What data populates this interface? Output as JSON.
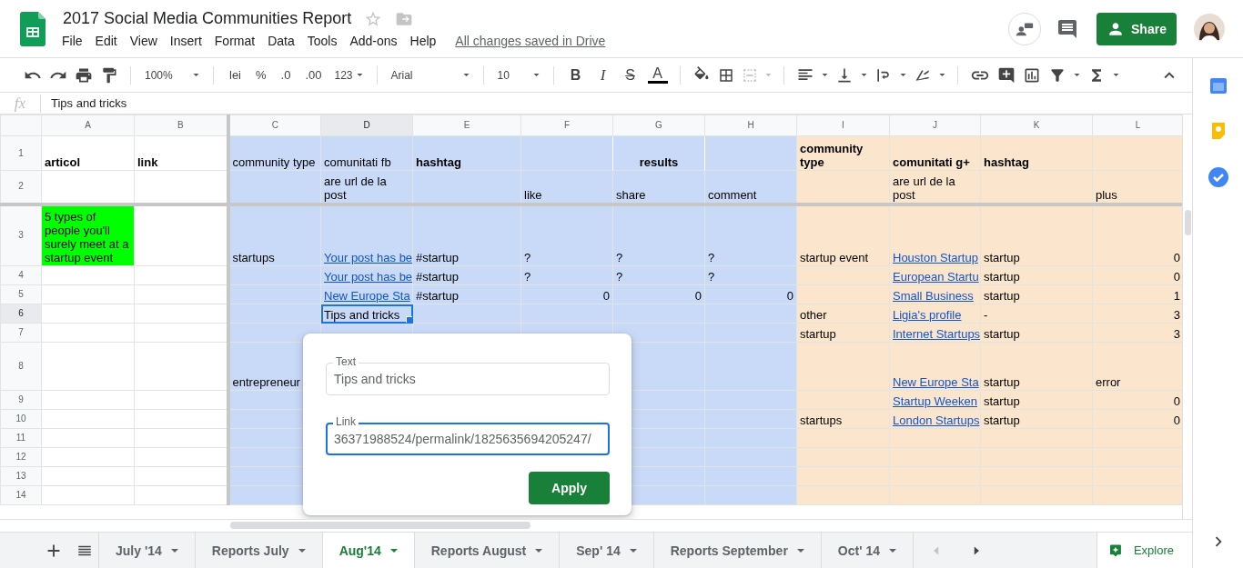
{
  "document": {
    "title": "2017 Social Media Communities Report",
    "starred": false,
    "save_status": "All changes saved in Drive"
  },
  "menu": [
    "File",
    "Edit",
    "View",
    "Insert",
    "Format",
    "Data",
    "Tools",
    "Add-ons",
    "Help"
  ],
  "share_button": "Share",
  "toolbar": {
    "zoom": "100%",
    "currency": "lei",
    "percent": "%",
    "decrease_decimals": ".0",
    "increase_decimals": ".00",
    "more_formats": "123",
    "font": "Arial",
    "font_size": "10",
    "bold": "B",
    "italic": "I",
    "strikethrough": "S",
    "text_color": "A"
  },
  "formula_bar": {
    "label": "fx",
    "value": "Tips and tricks"
  },
  "sheet": {
    "columns": [
      {
        "letter": "A",
        "selected": false
      },
      {
        "letter": "B",
        "selected": false
      },
      {
        "letter": "C",
        "selected": false,
        "color": "#c9daf8"
      },
      {
        "letter": "D",
        "selected": true,
        "color": "#c9daf8"
      },
      {
        "letter": "E",
        "selected": false,
        "color": "#c9daf8"
      },
      {
        "letter": "F",
        "selected": false,
        "color": "#c9daf8"
      },
      {
        "letter": "G",
        "selected": false,
        "color": "#c9daf8"
      },
      {
        "letter": "H",
        "selected": false,
        "color": "#c9daf8"
      },
      {
        "letter": "I",
        "selected": false,
        "color": "#fce5cd"
      },
      {
        "letter": "J",
        "selected": false,
        "color": "#fce5cd"
      },
      {
        "letter": "K",
        "selected": false,
        "color": "#fce5cd"
      },
      {
        "letter": "L",
        "selected": false,
        "color": "#fce5cd"
      }
    ],
    "rows": [
      {
        "number": "1",
        "selected": false,
        "cells": [
          {
            "text": "articol",
            "kind": "header",
            "selected": false
          },
          {
            "text": "link",
            "kind": "header",
            "selected": false
          },
          {
            "text": "community type",
            "kind": "text",
            "selected": false
          },
          {
            "text": "comunitati fb",
            "kind": "text",
            "selected": false
          },
          {
            "text": "hashtag",
            "kind": "header",
            "selected": false
          },
          null,
          {
            "text": "results",
            "kind": "group-header",
            "selected": false
          },
          null,
          {
            "text": "community type",
            "kind": "header",
            "selected": false
          },
          {
            "text": "comunitati g+",
            "kind": "header",
            "selected": false
          },
          {
            "text": "hashtag",
            "kind": "header",
            "selected": false
          },
          null
        ]
      },
      {
        "number": "2",
        "selected": false,
        "cells": [
          null,
          null,
          null,
          {
            "text": "are url de la post",
            "kind": "text",
            "selected": false
          },
          null,
          {
            "text": "like",
            "kind": "text",
            "selected": false
          },
          {
            "text": "share",
            "kind": "text",
            "selected": false
          },
          {
            "text": "comment",
            "kind": "text",
            "selected": false
          },
          null,
          {
            "text": "are url de la post",
            "kind": "text",
            "selected": false
          },
          null,
          {
            "text": "plus",
            "kind": "text",
            "selected": false
          }
        ]
      },
      {
        "number": "3",
        "selected": false,
        "cells": [
          {
            "text": "5 types of people you'll surely meet at a startup event",
            "kind": "text",
            "color": "#00ff00",
            "selected": false
          },
          null,
          {
            "text": "startups",
            "kind": "text",
            "selected": false
          },
          {
            "text": "Your post has be",
            "kind": "link",
            "selected": false
          },
          {
            "text": "#startup",
            "kind": "text",
            "selected": false
          },
          {
            "text": "?",
            "kind": "text",
            "selected": false
          },
          {
            "text": "?",
            "kind": "text",
            "selected": false
          },
          {
            "text": "?",
            "kind": "text",
            "selected": false
          },
          {
            "text": "startup event",
            "kind": "text",
            "selected": false
          },
          {
            "text": "Houston Startup",
            "kind": "link",
            "selected": false
          },
          {
            "text": "startup",
            "kind": "text",
            "selected": false
          },
          {
            "text": "0",
            "kind": "number",
            "selected": false
          }
        ]
      },
      {
        "number": "4",
        "selected": false,
        "cells": [
          null,
          null,
          null,
          {
            "text": "Your post has be",
            "kind": "link",
            "selected": false
          },
          {
            "text": "#startup",
            "kind": "text",
            "selected": false
          },
          {
            "text": "?",
            "kind": "text",
            "selected": false
          },
          {
            "text": "?",
            "kind": "text",
            "selected": false
          },
          {
            "text": "?",
            "kind": "text",
            "selected": false
          },
          null,
          {
            "text": "European Startu",
            "kind": "link",
            "selected": false
          },
          {
            "text": "startup",
            "kind": "text",
            "selected": false
          },
          {
            "text": "0",
            "kind": "number",
            "selected": false
          }
        ]
      },
      {
        "number": "5",
        "selected": false,
        "cells": [
          null,
          null,
          null,
          {
            "text": "New Europe Sta",
            "kind": "link",
            "selected": false
          },
          {
            "text": "#startup",
            "kind": "text",
            "selected": false
          },
          {
            "text": "0",
            "kind": "number",
            "selected": false
          },
          {
            "text": "0",
            "kind": "number",
            "selected": false
          },
          {
            "text": "0",
            "kind": "number",
            "selected": false
          },
          null,
          {
            "text": "Small Business",
            "kind": "link",
            "selected": false
          },
          {
            "text": "startup",
            "kind": "text",
            "selected": false
          },
          {
            "text": "1",
            "kind": "number",
            "selected": false
          }
        ]
      },
      {
        "number": "6",
        "selected": true,
        "cells": [
          null,
          null,
          null,
          {
            "text": "Tips and tricks",
            "kind": "text",
            "selected": true
          },
          null,
          null,
          null,
          null,
          {
            "text": "other",
            "kind": "text",
            "selected": false
          },
          {
            "text": "Ligia's profile",
            "kind": "link",
            "selected": false
          },
          {
            "text": "-",
            "kind": "text",
            "selected": false
          },
          {
            "text": "3",
            "kind": "number",
            "selected": false
          }
        ]
      },
      {
        "number": "7",
        "selected": false,
        "cells": [
          null,
          null,
          null,
          null,
          null,
          null,
          null,
          null,
          {
            "text": "startup",
            "kind": "text",
            "selected": false
          },
          {
            "text": "Internet Startups",
            "kind": "link",
            "selected": false
          },
          {
            "text": "startup",
            "kind": "text",
            "selected": false
          },
          {
            "text": "3",
            "kind": "number",
            "selected": false
          }
        ]
      },
      {
        "number": "8",
        "selected": false,
        "cells": [
          null,
          null,
          {
            "text": "entrepreneur",
            "kind": "text",
            "selected": false
          },
          null,
          null,
          null,
          null,
          null,
          null,
          {
            "text": "New Europe Sta",
            "kind": "link",
            "selected": false
          },
          {
            "text": "startup",
            "kind": "text",
            "selected": false
          },
          {
            "text": "error",
            "kind": "text",
            "selected": false
          }
        ]
      },
      {
        "number": "9",
        "selected": false,
        "cells": [
          null,
          null,
          null,
          null,
          null,
          null,
          null,
          null,
          null,
          {
            "text": "Startup Weeken",
            "kind": "link",
            "selected": false
          },
          {
            "text": "startup",
            "kind": "text",
            "selected": false
          },
          {
            "text": "0",
            "kind": "number",
            "selected": false
          }
        ]
      },
      {
        "number": "10",
        "selected": false,
        "cells": [
          null,
          null,
          null,
          null,
          null,
          null,
          null,
          null,
          {
            "text": "startups",
            "kind": "text",
            "selected": false
          },
          {
            "text": "London Startups",
            "kind": "link",
            "selected": false
          },
          {
            "text": "startup",
            "kind": "text",
            "selected": false
          },
          {
            "text": "0",
            "kind": "number",
            "selected": false
          }
        ]
      },
      {
        "number": "11",
        "selected": false,
        "cells": [
          null,
          null,
          null,
          null,
          null,
          null,
          null,
          null,
          null,
          null,
          null,
          null
        ]
      },
      {
        "number": "12",
        "selected": false,
        "cells": [
          null,
          null,
          null,
          null,
          null,
          null,
          null,
          null,
          null,
          null,
          null,
          null
        ]
      },
      {
        "number": "13",
        "selected": false,
        "cells": [
          null,
          null,
          null,
          null,
          null,
          null,
          null,
          null,
          null,
          null,
          null,
          null
        ]
      },
      {
        "number": "14",
        "selected": false,
        "cells": [
          null,
          null,
          null,
          null,
          null,
          null,
          null,
          null,
          null,
          null,
          null,
          null
        ]
      }
    ]
  },
  "link_dialog": {
    "text_field": {
      "label": "Text",
      "value": "Tips and tricks",
      "focused": false
    },
    "link_field": {
      "label": "Link",
      "value": "36371988524/permalink/1825635694205247/",
      "focused": true
    },
    "apply_button": "Apply"
  },
  "sheet_tabs": [
    {
      "label": "July '14",
      "selected": false
    },
    {
      "label": "Reports July",
      "selected": false
    },
    {
      "label": "Aug'14",
      "selected": true
    },
    {
      "label": "Reports August",
      "selected": false
    },
    {
      "label": "Sep' 14",
      "selected": false
    },
    {
      "label": "Reports September",
      "selected": false
    },
    {
      "label": "Oct' 14",
      "selected": false
    }
  ],
  "explore_button": "Explore"
}
